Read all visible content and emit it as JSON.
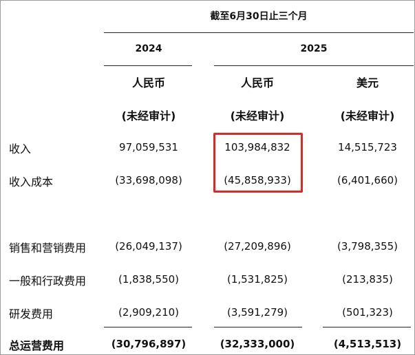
{
  "header": {
    "period": "截至6月30日止三个月",
    "years": [
      "2024",
      "2025"
    ],
    "currencies": [
      "人民币",
      "人民币",
      "美元"
    ],
    "audit_notes": [
      "(未经审计)",
      "(未经审计)",
      "(未经审计)"
    ]
  },
  "rows": [
    {
      "label": "收入",
      "values": [
        "97,059,531",
        "103,984,832",
        "14,515,723"
      ]
    },
    {
      "label": "收入成本",
      "values": [
        "(33,698,098)",
        "(45,858,933)",
        "(6,401,660)"
      ]
    },
    {
      "label": "销售和营销费用",
      "values": [
        "(26,049,137)",
        "(27,209,896)",
        "(3,798,355)"
      ]
    },
    {
      "label": "一般和行政费用",
      "values": [
        "(1,838,550)",
        "(1,531,825)",
        "(213,835)"
      ]
    },
    {
      "label": "研发费用",
      "values": [
        "(2,909,210)",
        "(3,591,279)",
        "(501,323)"
      ]
    },
    {
      "label": "总运营费用",
      "values": [
        "(30,796,897)",
        "(32,333,000)",
        "(4,513,513)"
      ]
    }
  ],
  "colors": {
    "highlight_border": "#e5261f",
    "text": "#111111",
    "rule": "#222222"
  }
}
